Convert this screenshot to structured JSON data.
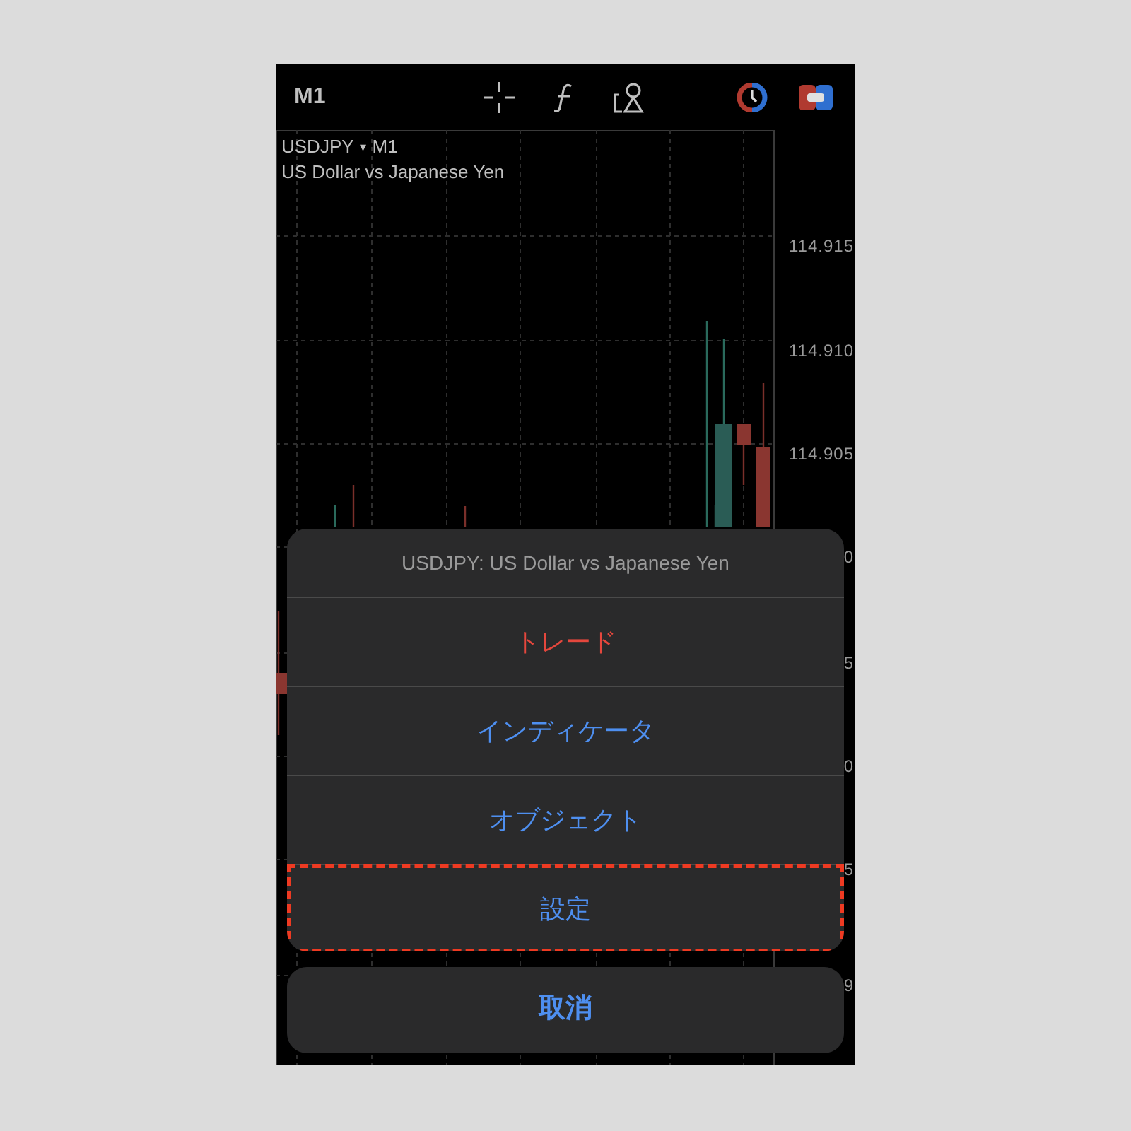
{
  "toolbar": {
    "timeframe": "M1"
  },
  "chart": {
    "symbol": "USDJPY",
    "symbol_caret": "▾",
    "timeframe": "M1",
    "description": "US Dollar vs Japanese Yen",
    "price_labels": [
      "114.915",
      "114.910",
      "114.905",
      "0",
      "5",
      "0",
      "5",
      "9"
    ]
  },
  "action_sheet": {
    "title": "USDJPY: US Dollar vs Japanese Yen",
    "items": [
      {
        "label": "トレード",
        "kind": "destructive",
        "highlighted": false
      },
      {
        "label": "インディケータ",
        "kind": "default",
        "highlighted": false
      },
      {
        "label": "オブジェクト",
        "kind": "default",
        "highlighted": false
      },
      {
        "label": "設定",
        "kind": "default",
        "highlighted": true
      }
    ],
    "cancel": "取消"
  }
}
